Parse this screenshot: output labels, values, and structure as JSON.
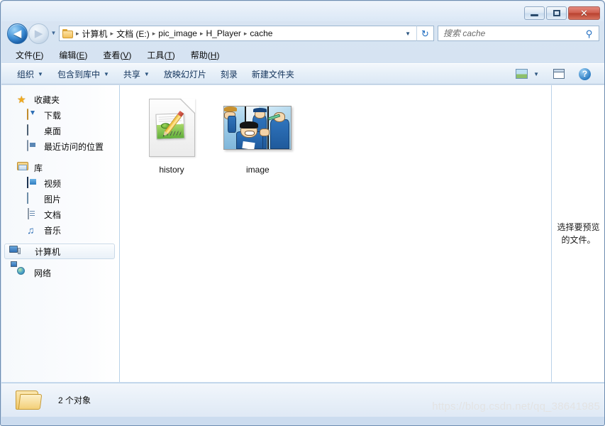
{
  "window": {
    "controls": {
      "minimize": "–",
      "maximize": "□",
      "close": "✕"
    }
  },
  "address_bar": {
    "back_glyph": "◀",
    "forward_glyph": "▶",
    "history_caret": "▼",
    "breadcrumbs": [
      "计算机",
      "文档 (E:)",
      "pic_image",
      "H_Player",
      "cache"
    ],
    "separator": "▸",
    "dropdown_caret": "▼",
    "refresh_glyph": "↻",
    "search": {
      "placeholder": "搜索 cache",
      "value": "",
      "icon": "⚲"
    }
  },
  "menu_bar": {
    "items": [
      {
        "label": "文件",
        "key": "F"
      },
      {
        "label": "编辑",
        "key": "E"
      },
      {
        "label": "查看",
        "key": "V"
      },
      {
        "label": "工具",
        "key": "T"
      },
      {
        "label": "帮助",
        "key": "H"
      }
    ]
  },
  "toolbar": {
    "items": [
      {
        "label": "组织",
        "has_caret": true
      },
      {
        "label": "包含到库中",
        "has_caret": true
      },
      {
        "label": "共享",
        "has_caret": true
      },
      {
        "label": "放映幻灯片",
        "has_caret": false
      },
      {
        "label": "刻录",
        "has_caret": false
      },
      {
        "label": "新建文件夹",
        "has_caret": false
      }
    ],
    "view_caret": "▼",
    "help_glyph": "?"
  },
  "nav_pane": {
    "groups": [
      {
        "header": {
          "label": "收藏夹",
          "icon": "star-icon"
        },
        "children": [
          {
            "label": "下载",
            "icon": "download-folder-icon"
          },
          {
            "label": "桌面",
            "icon": "desktop-icon"
          },
          {
            "label": "最近访问的位置",
            "icon": "recent-places-icon"
          }
        ]
      },
      {
        "header": {
          "label": "库",
          "icon": "libraries-icon"
        },
        "children": [
          {
            "label": "视频",
            "icon": "video-library-icon"
          },
          {
            "label": "图片",
            "icon": "pictures-library-icon"
          },
          {
            "label": "文档",
            "icon": "documents-library-icon"
          },
          {
            "label": "音乐",
            "icon": "music-library-icon"
          }
        ]
      },
      {
        "header": {
          "label": "计算机",
          "icon": "computer-icon",
          "selected": true
        },
        "children": []
      },
      {
        "header": {
          "label": "网络",
          "icon": "network-icon"
        },
        "children": []
      }
    ]
  },
  "file_pane": {
    "items": [
      {
        "label": "history",
        "type": "document"
      },
      {
        "label": "image",
        "type": "image-thumbnail"
      }
    ]
  },
  "preview_pane": {
    "message": "选择要预览的文件。"
  },
  "status_bar": {
    "text": "2 个对象"
  },
  "watermark": {
    "text": "https://blog.csdn.net/qq_38641985"
  },
  "colors": {
    "frame": "#6d8cb0",
    "accent_blue": "#1d6bbf",
    "close_red": "#b8412f",
    "pane_divider": "#b9d2e8"
  }
}
